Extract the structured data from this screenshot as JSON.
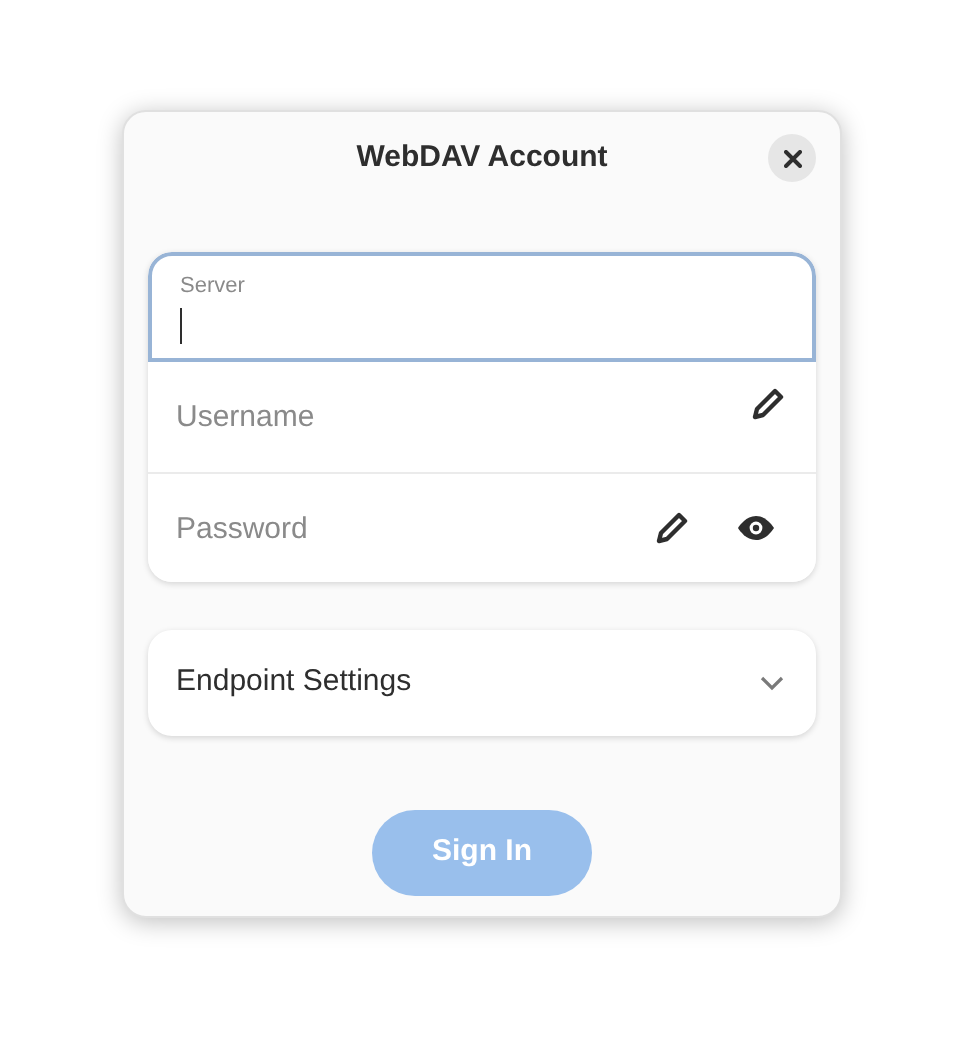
{
  "window": {
    "title": "WebDAV Account"
  },
  "fields": [
    {
      "kind": "text",
      "label": "Server",
      "focused": true
    },
    {
      "kind": "text",
      "placeholder": "Username",
      "focused": false
    },
    {
      "kind": "password",
      "placeholder": "Password",
      "focused": false
    }
  ],
  "expander": {
    "label": "Endpoint Settings",
    "expanded": false
  },
  "sign_in": {
    "label": "Sign In",
    "disabled": true
  }
}
